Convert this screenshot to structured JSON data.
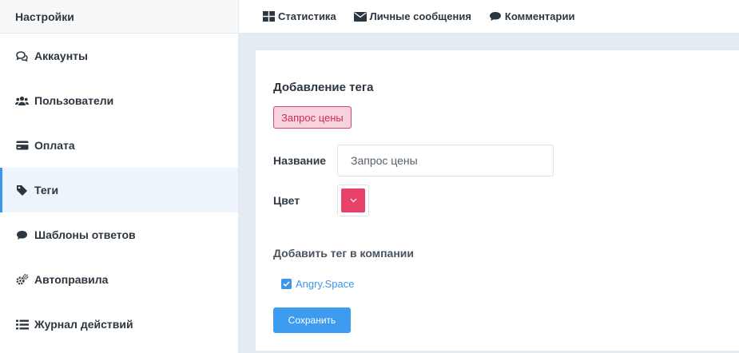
{
  "sidebar": {
    "title": "Настройки",
    "items": [
      {
        "label": "Аккаунты",
        "icon": "chat-bubbles-icon"
      },
      {
        "label": "Пользователи",
        "icon": "users-icon"
      },
      {
        "label": "Оплата",
        "icon": "credit-card-icon"
      },
      {
        "label": "Теги",
        "icon": "tag-icon",
        "active": true
      },
      {
        "label": "Шаблоны ответов",
        "icon": "comment-icon"
      },
      {
        "label": "Автоправила",
        "icon": "gears-icon"
      },
      {
        "label": "Журнал действий",
        "icon": "list-icon"
      }
    ]
  },
  "topbar": {
    "links": [
      {
        "label": "Статистика",
        "icon": "dashboard-icon"
      },
      {
        "label": "Личные сообщения",
        "icon": "envelope-icon"
      },
      {
        "label": "Комментарии",
        "icon": "comment-icon"
      }
    ]
  },
  "form": {
    "title": "Добавление тега",
    "tag_preview": "Запрос цены",
    "name_label": "Название",
    "name_value": "Запрос цены",
    "color_label": "Цвет",
    "color_value": "#e8426a",
    "companies_title": "Добавить тег в компании",
    "companies": [
      {
        "label": "Angry.Space",
        "checked": true
      }
    ],
    "save_label": "Сохранить"
  },
  "colors": {
    "accent": "#3e96ea",
    "tag_border": "#d9436c",
    "tag_bg": "#f7d3dd",
    "page_bg": "#e3ebf3"
  }
}
